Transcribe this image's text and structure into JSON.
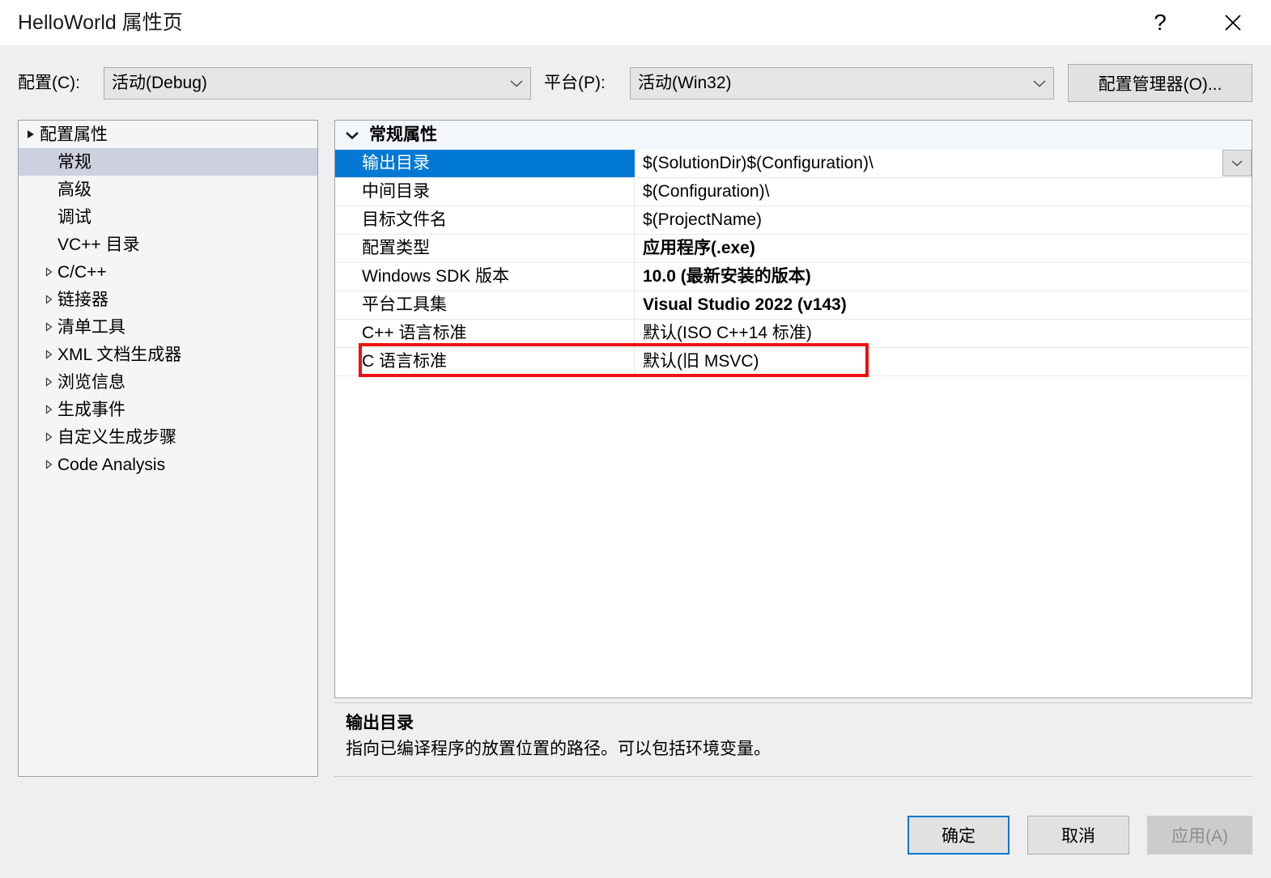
{
  "window": {
    "title": "HelloWorld 属性页",
    "help_icon": "question-mark-icon",
    "close_icon": "close-x-icon"
  },
  "configbar": {
    "config_label": "配置(C):",
    "config_value": "活动(Debug)",
    "platform_label": "平台(P):",
    "platform_value": "活动(Win32)",
    "config_manager_button": "配置管理器(O)..."
  },
  "tree": {
    "items": [
      {
        "label": "配置属性",
        "level": 0,
        "state": "expanded",
        "selected": false
      },
      {
        "label": "常规",
        "level": 1,
        "state": "leaf",
        "selected": true
      },
      {
        "label": "高级",
        "level": 1,
        "state": "leaf",
        "selected": false
      },
      {
        "label": "调试",
        "level": 1,
        "state": "leaf",
        "selected": false
      },
      {
        "label": "VC++ 目录",
        "level": 1,
        "state": "leaf",
        "selected": false
      },
      {
        "label": "C/C++",
        "level": 1,
        "state": "collapsed",
        "selected": false
      },
      {
        "label": "链接器",
        "level": 1,
        "state": "collapsed",
        "selected": false
      },
      {
        "label": "清单工具",
        "level": 1,
        "state": "collapsed",
        "selected": false
      },
      {
        "label": "XML 文档生成器",
        "level": 1,
        "state": "collapsed",
        "selected": false
      },
      {
        "label": "浏览信息",
        "level": 1,
        "state": "collapsed",
        "selected": false
      },
      {
        "label": "生成事件",
        "level": 1,
        "state": "collapsed",
        "selected": false
      },
      {
        "label": "自定义生成步骤",
        "level": 1,
        "state": "collapsed",
        "selected": false
      },
      {
        "label": "Code Analysis",
        "level": 1,
        "state": "collapsed",
        "selected": false
      }
    ]
  },
  "grid": {
    "group_header": "常规属性",
    "group_chevron": "chevron-down-icon",
    "rows": [
      {
        "name": "输出目录",
        "value": "$(SolutionDir)$(Configuration)\\",
        "selected": true,
        "bold": false,
        "dropdown": true
      },
      {
        "name": "中间目录",
        "value": "$(Configuration)\\",
        "selected": false,
        "bold": false,
        "dropdown": false
      },
      {
        "name": "目标文件名",
        "value": "$(ProjectName)",
        "selected": false,
        "bold": false,
        "dropdown": false
      },
      {
        "name": "配置类型",
        "value": "应用程序(.exe)",
        "selected": false,
        "bold": true,
        "dropdown": false
      },
      {
        "name": "Windows SDK 版本",
        "value": "10.0 (最新安装的版本)",
        "selected": false,
        "bold": true,
        "dropdown": false
      },
      {
        "name": "平台工具集",
        "value": "Visual Studio 2022 (v143)",
        "selected": false,
        "bold": true,
        "dropdown": false
      },
      {
        "name": "C++ 语言标准",
        "value": "默认(ISO C++14 标准)",
        "selected": false,
        "bold": false,
        "dropdown": false
      },
      {
        "name": "C 语言标准",
        "value": "默认(旧 MSVC)",
        "selected": false,
        "bold": false,
        "dropdown": false
      }
    ]
  },
  "annotation": {
    "highlight_color": "#ee1111",
    "target_row": "C 语言标准"
  },
  "description": {
    "title": "输出目录",
    "text": "指向已编译程序的放置位置的路径。可以包括环境变量。"
  },
  "footer": {
    "ok_label": "确定",
    "cancel_label": "取消",
    "apply_label": "应用(A)"
  },
  "colors": {
    "selection_blue": "#0078d4",
    "tree_selection": "#cdd0de",
    "dialog_bg": "#efefef",
    "annotation_red": "#ee1111"
  }
}
